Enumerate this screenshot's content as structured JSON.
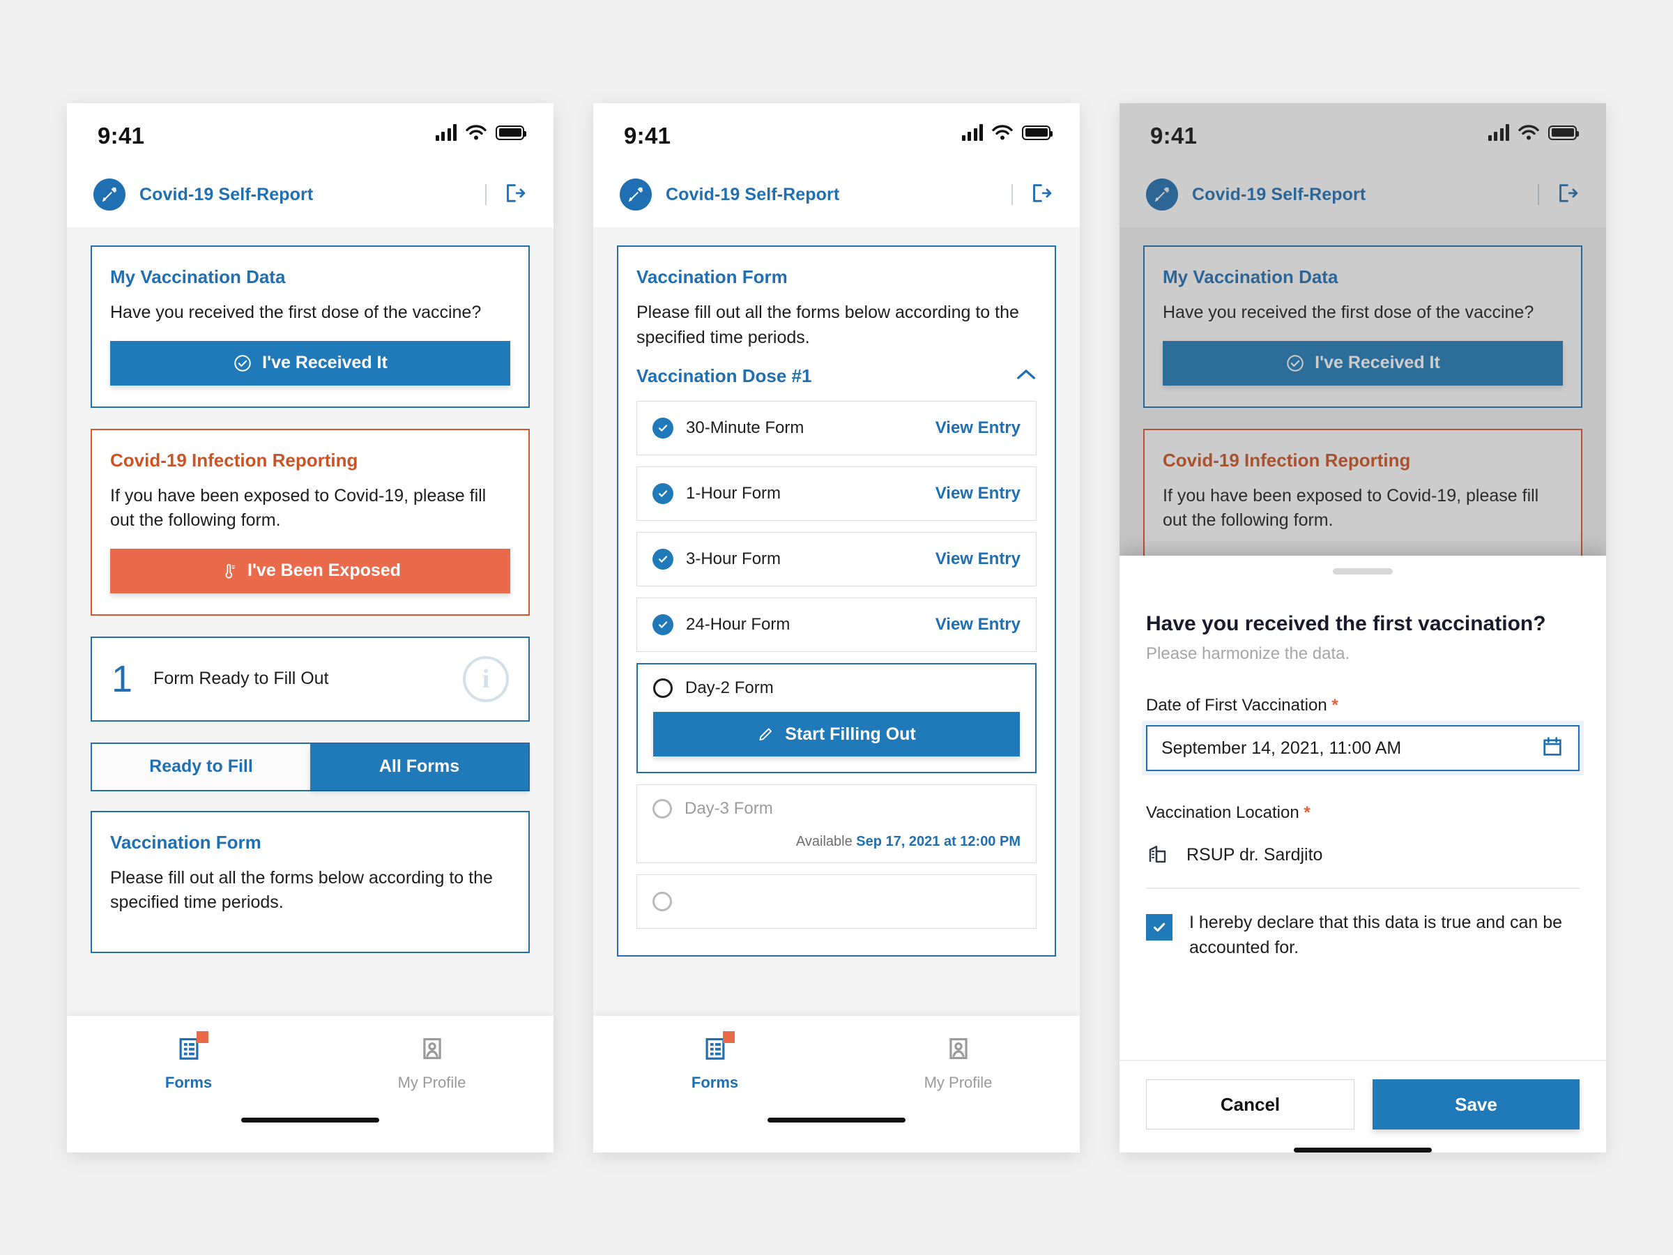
{
  "status_bar": {
    "time": "9:41",
    "signal_icon": "cellular-signal-icon",
    "wifi_icon": "wifi-icon",
    "battery_icon": "battery-icon"
  },
  "app_header": {
    "title": "Covid-19 Self-Report",
    "logo_icon": "syringe-icon",
    "logout_icon": "logout-icon"
  },
  "colors": {
    "primary_blue": "#2079b8",
    "title_blue": "#1f6fb2",
    "accent_orange": "#ea6a4c",
    "orange_title": "#cc5324",
    "required_star": "#e2603a"
  },
  "screen1": {
    "vaccination_card": {
      "title": "My Vaccination Data",
      "question": "Have you received the first dose of the vaccine?",
      "button_label": "I've Received It",
      "button_icon": "check-circle-icon"
    },
    "infection_card": {
      "title": "Covid-19 Infection Reporting",
      "text": "If you have been exposed to Covid-19, please fill out the following form.",
      "button_label": "I've Been Exposed",
      "button_icon": "thermometer-icon"
    },
    "counter": {
      "number": "1",
      "label": "Form Ready to Fill Out",
      "info_icon": "info-circle-icon",
      "info_glyph": "i"
    },
    "tabs": [
      {
        "label": "Ready to Fill",
        "active": false
      },
      {
        "label": "All Forms",
        "active": true
      }
    ],
    "forms_card": {
      "title": "Vaccination Form",
      "text": "Please fill out all the forms below according to the specified time periods."
    }
  },
  "screen2": {
    "forms_card": {
      "title": "Vaccination Form",
      "text": "Please fill out all the forms below according to the specified time periods.",
      "dose_title": "Vaccination Dose #1",
      "collapse_icon": "chevron-up-icon"
    },
    "rows": [
      {
        "label": "30-Minute Form",
        "state": "done",
        "action": "View Entry"
      },
      {
        "label": "1-Hour Form",
        "state": "done",
        "action": "View Entry"
      },
      {
        "label": "3-Hour Form",
        "state": "done",
        "action": "View Entry"
      },
      {
        "label": "24-Hour Form",
        "state": "done",
        "action": "View Entry"
      },
      {
        "label": "Day-2 Form",
        "state": "active",
        "action": "Start Filling Out",
        "action_icon": "pencil-icon"
      },
      {
        "label": "Day-3 Form",
        "state": "locked",
        "available_prefix": "Available",
        "available_date": "Sep 17, 2021 at 12:00 PM"
      }
    ]
  },
  "screen3": {
    "sheet": {
      "title": "Have you received the first vaccination?",
      "subtitle": "Please harmonize the data.",
      "date_label": "Date of First Vaccination",
      "date_required": "*",
      "date_value": "September 14, 2021, 11:00 AM",
      "date_icon": "calendar-icon",
      "location_label": "Vaccination Location",
      "location_required": "*",
      "location_value": "RSUP dr. Sardjito",
      "location_icon": "building-icon",
      "declaration": "I hereby declare that this data is true and can be accounted for.",
      "checkbox_icon": "checkmark-icon",
      "cancel_label": "Cancel",
      "save_label": "Save"
    }
  },
  "bottom_nav": {
    "items": [
      {
        "label": "Forms",
        "icon": "forms-list-icon",
        "active": true,
        "badge": true
      },
      {
        "label": "My Profile",
        "icon": "profile-card-icon",
        "active": false,
        "badge": false
      }
    ]
  }
}
